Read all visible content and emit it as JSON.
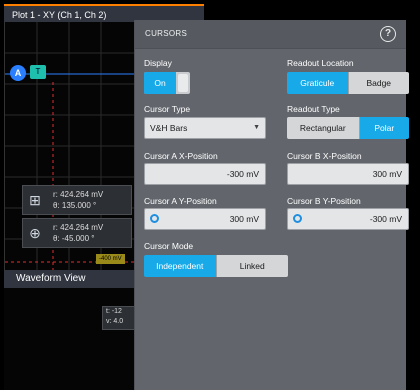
{
  "plot": {
    "title": "Plot 1 - XY (Ch 1, Ch 2)",
    "marker_a": "A",
    "marker_t": "T",
    "readout_1": {
      "r": "r:  424.264 mV",
      "theta": "θ:  135.000 °"
    },
    "readout_2": {
      "r": "r:  424.264 mV",
      "theta": "θ:  -45.000 °"
    },
    "cursor_level": "-400 mV"
  },
  "waveform_view": {
    "title": "Waveform View",
    "readout_line_1": "t: -12",
    "readout_line_2": "v: 4.0"
  },
  "dialog": {
    "title": "CURSORS",
    "help_label": "?",
    "display": {
      "label": "Display",
      "value": "On"
    },
    "readout_location": {
      "label": "Readout Location",
      "options": [
        "Graticule",
        "Badge"
      ],
      "selected": "Graticule"
    },
    "cursor_type": {
      "label": "Cursor Type",
      "value": "V&H Bars"
    },
    "readout_type": {
      "label": "Readout Type",
      "options": [
        "Rectangular",
        "Polar"
      ],
      "selected": "Polar"
    },
    "cursor_a_x": {
      "label": "Cursor A X-Position",
      "value": "-300 mV"
    },
    "cursor_b_x": {
      "label": "Cursor B X-Position",
      "value": "300 mV"
    },
    "cursor_a_y": {
      "label": "Cursor A Y-Position",
      "value": "300 mV"
    },
    "cursor_b_y": {
      "label": "Cursor B Y-Position",
      "value": "-300 mV"
    },
    "cursor_mode": {
      "label": "Cursor Mode",
      "options": [
        "Independent",
        "Linked"
      ],
      "selected": "Independent"
    }
  },
  "colors": {
    "accent": "#18a9e8",
    "cursor_line": "#e03030",
    "marker_a": "#2a7fff",
    "marker_t": "#1fbfae",
    "plot_title_accent": "#ff7f00"
  },
  "icons": {
    "readout_1": "grid-cross-icon",
    "readout_2": "circle-cross-icon",
    "help": "help-icon",
    "dropdown": "chevron-down-icon",
    "multipurpose_knob": "knob-icon"
  }
}
